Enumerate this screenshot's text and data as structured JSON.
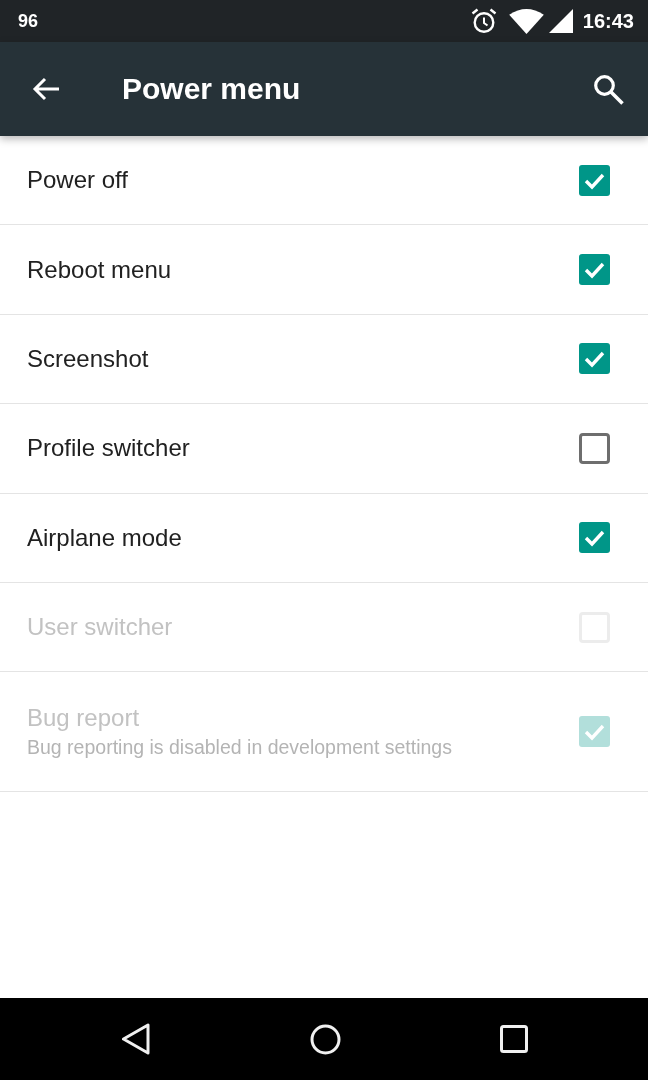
{
  "status_bar": {
    "status_text": "96",
    "time": "16:43"
  },
  "toolbar": {
    "title": "Power menu"
  },
  "items": [
    {
      "title": "Power off",
      "checked": true,
      "disabled": false
    },
    {
      "title": "Reboot menu",
      "checked": true,
      "disabled": false
    },
    {
      "title": "Screenshot",
      "checked": true,
      "disabled": false
    },
    {
      "title": "Profile switcher",
      "checked": false,
      "disabled": false
    },
    {
      "title": "Airplane mode",
      "checked": true,
      "disabled": false
    },
    {
      "title": "User switcher",
      "checked": false,
      "disabled": true
    },
    {
      "title": "Bug report",
      "summary": "Bug reporting is disabled in development settings",
      "checked": true,
      "disabled": true
    }
  ]
}
